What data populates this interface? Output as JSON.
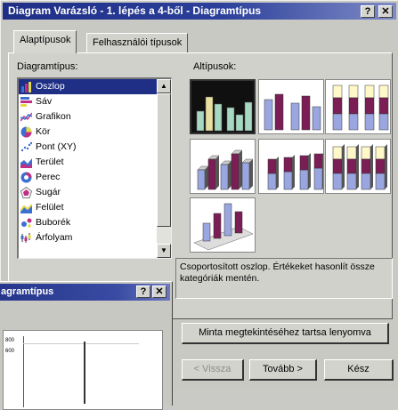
{
  "window": {
    "title": "Diagram Varázsló - 1. lépés a 4-ből - Diagramtípus",
    "help_btn": "?",
    "close_btn": "✕"
  },
  "tabs": [
    {
      "label": "Alaptípusok",
      "active": true
    },
    {
      "label": "Felhasználói típusok",
      "active": false
    }
  ],
  "chart_types": {
    "label": "Diagramtípus:",
    "items": [
      {
        "label": "Oszlop",
        "icon": "column-chart-icon",
        "selected": true
      },
      {
        "label": "Sáv",
        "icon": "bar-chart-icon"
      },
      {
        "label": "Grafikon",
        "icon": "line-chart-icon"
      },
      {
        "label": "Kör",
        "icon": "pie-chart-icon"
      },
      {
        "label": "Pont (XY)",
        "icon": "scatter-chart-icon"
      },
      {
        "label": "Terület",
        "icon": "area-chart-icon"
      },
      {
        "label": "Perec",
        "icon": "doughnut-chart-icon"
      },
      {
        "label": "Sugár",
        "icon": "radar-chart-icon"
      },
      {
        "label": "Felület",
        "icon": "surface-chart-icon"
      },
      {
        "label": "Buborék",
        "icon": "bubble-chart-icon"
      },
      {
        "label": "Árfolyam",
        "icon": "stock-chart-icon"
      }
    ]
  },
  "subtypes": {
    "label": "Altípusok:",
    "selected_index": 0,
    "description": "Csoportosított oszlop. Értékeket hasonlít össze kategóriák mentén.",
    "colors": {
      "a": "#7b1e55",
      "b": "#9aa6e0",
      "c": "#fff8c8",
      "selected_bg": "#101010",
      "selected_bar": "#a7d8c2"
    }
  },
  "preview_button": "Minta megtekintéséhez tartsa lenyomva",
  "buttons": {
    "back": "< Vissza",
    "next": "Tovább >",
    "finish": "Kész"
  },
  "behind_window": {
    "title": "agramtípus",
    "help_btn": "?",
    "close_btn": "✕",
    "axis_ticks": [
      "800",
      "600"
    ]
  }
}
